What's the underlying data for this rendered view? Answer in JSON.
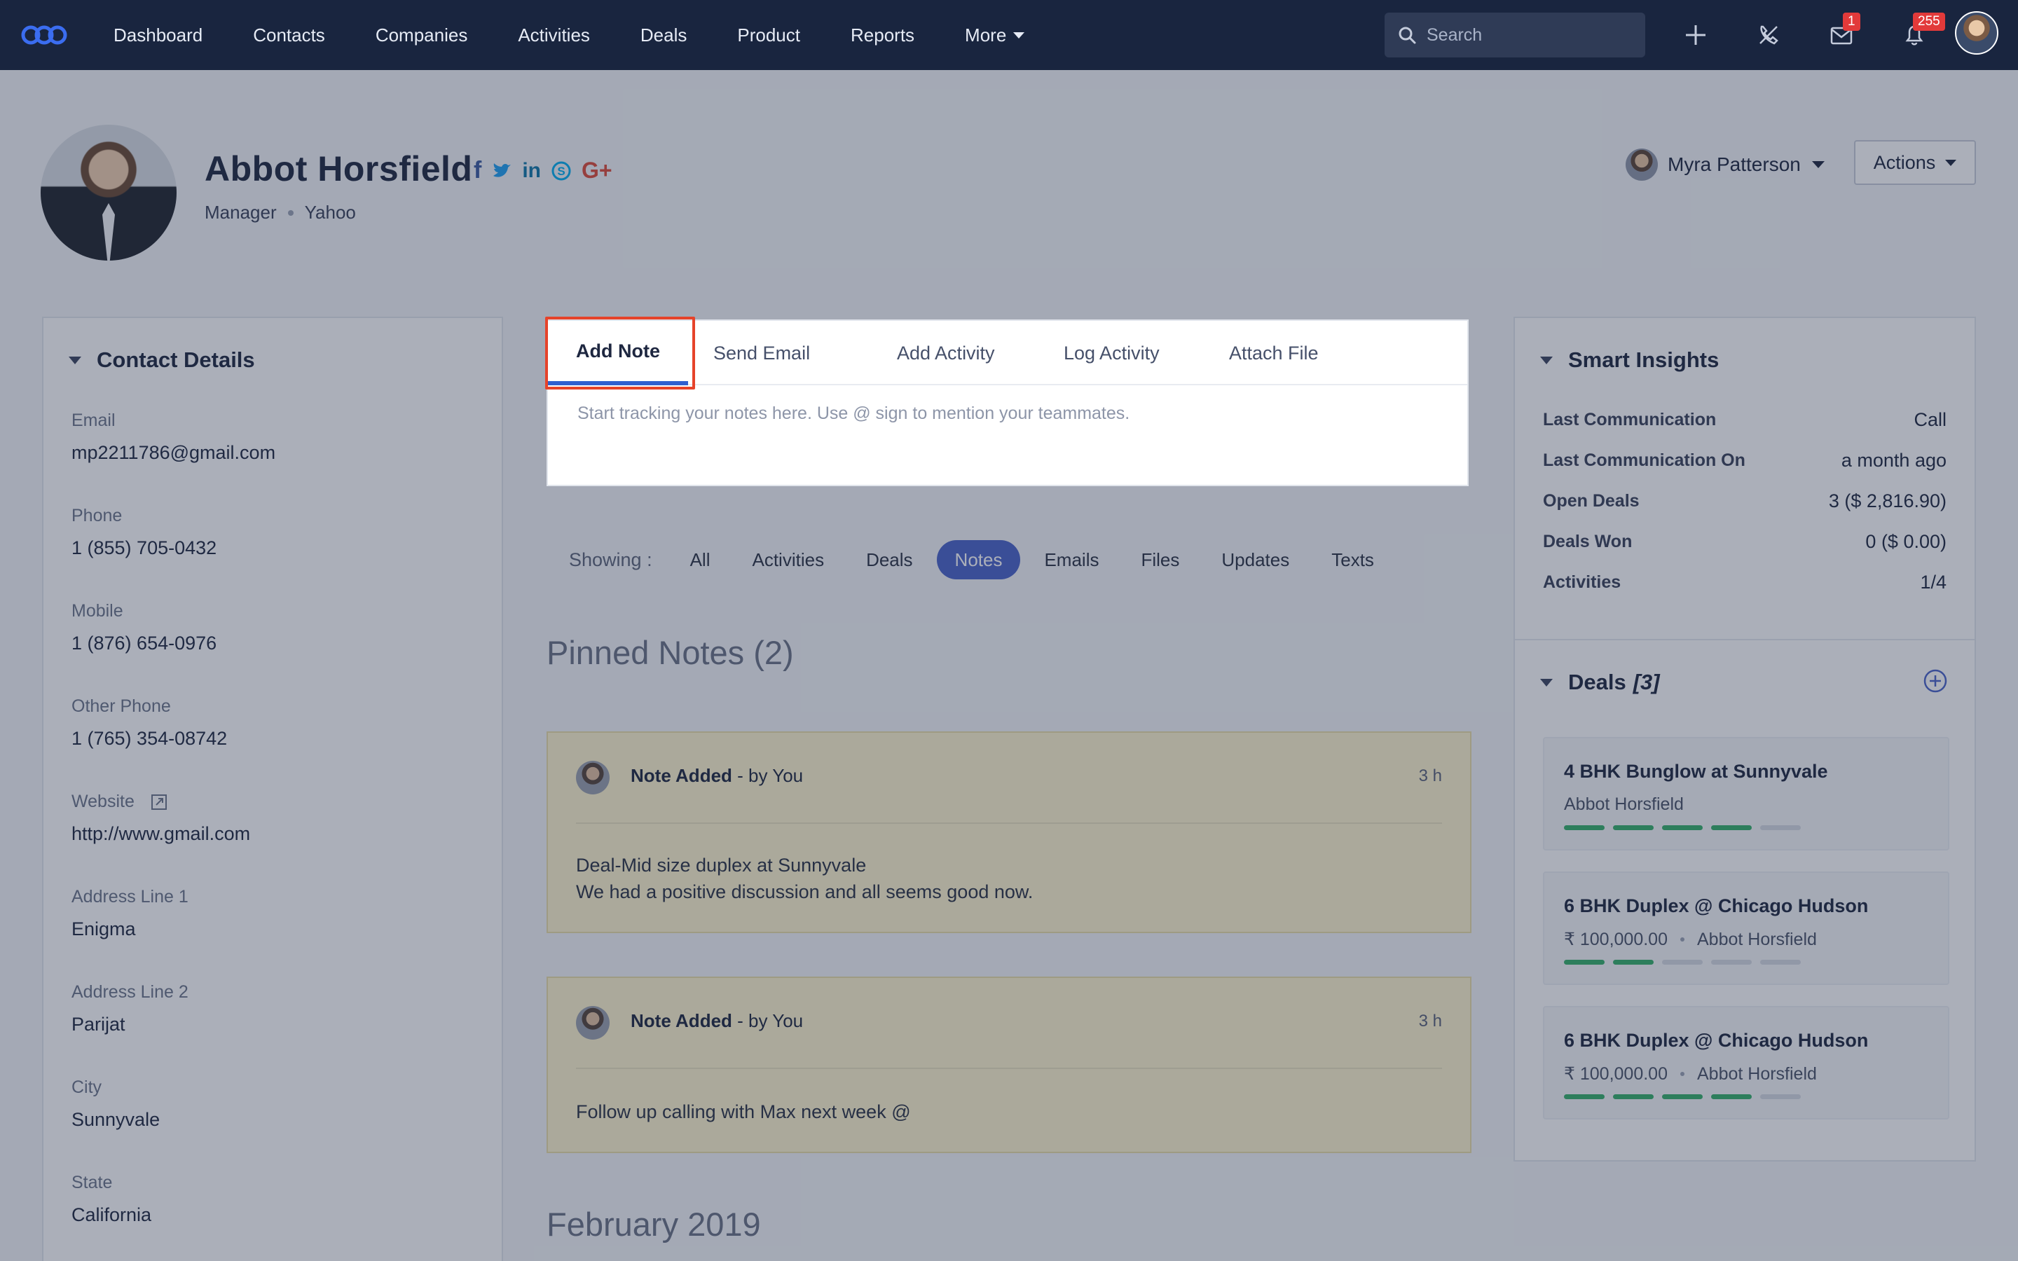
{
  "nav": {
    "items": [
      "Dashboard",
      "Contacts",
      "Companies",
      "Activities",
      "Deals",
      "Product",
      "Reports"
    ],
    "more_label": "More",
    "search_placeholder": "Search",
    "mail_badge": "1",
    "notification_badge": "255"
  },
  "contact": {
    "name": "Abbot Horsfield",
    "title": "Manager",
    "company": "Yahoo",
    "owner": "Myra Patterson",
    "actions_label": "Actions"
  },
  "contact_details": {
    "heading": "Contact Details",
    "fields": [
      {
        "label": "Email",
        "value": "mp2211786@gmail.com"
      },
      {
        "label": "Phone",
        "value": "1 (855) 705-0432"
      },
      {
        "label": "Mobile",
        "value": "1 (876) 654-0976"
      },
      {
        "label": "Other Phone",
        "value": "1 (765) 354-08742"
      },
      {
        "label": "Website",
        "value": "http://www.gmail.com"
      },
      {
        "label": "Address Line 1",
        "value": "Enigma"
      },
      {
        "label": "Address Line 2",
        "value": "Parijat"
      },
      {
        "label": "City",
        "value": "Sunnyvale"
      },
      {
        "label": "State",
        "value": "California"
      }
    ]
  },
  "composer": {
    "tabs": [
      "Add Note",
      "Send Email",
      "Add Activity",
      "Log Activity",
      "Attach File"
    ],
    "placeholder": "Start tracking your notes here. Use @ sign to mention your teammates."
  },
  "filters": {
    "label": "Showing :",
    "items": [
      "All",
      "Activities",
      "Deals",
      "Notes",
      "Emails",
      "Files",
      "Updates",
      "Texts"
    ],
    "active": "Notes"
  },
  "pinned_heading": "Pinned Notes (2)",
  "notes": [
    {
      "title": "Note Added",
      "by": " - by You",
      "time": "3 h",
      "line1": "Deal-Mid size duplex at Sunnyvale",
      "line2": "We had a positive discussion and all seems good now."
    },
    {
      "title": "Note Added",
      "by": " - by You",
      "time": "3 h",
      "line1": "Follow up calling with Max next week @",
      "line2": ""
    }
  ],
  "month_heading": "February 2019",
  "insights": {
    "heading": "Smart Insights",
    "rows": [
      {
        "key": "Last Communication",
        "value": "Call"
      },
      {
        "key": "Last Communication On",
        "value": "a month ago"
      },
      {
        "key": "Open Deals",
        "value": "3 ($ 2,816.90)"
      },
      {
        "key": "Deals Won",
        "value": "0 ($ 0.00)"
      },
      {
        "key": "Activities",
        "value": "1/4"
      }
    ]
  },
  "deals": {
    "heading": "Deals",
    "count": "[3]",
    "cards": [
      {
        "title": "4 BHK Bunglow at Sunnyvale",
        "amount": "",
        "contact": "Abbot Horsfield",
        "stages_done": 4,
        "stages_total": 5
      },
      {
        "title": "6 BHK Duplex @ Chicago Hudson",
        "amount": "₹ 100,000.00",
        "contact": "Abbot Horsfield",
        "stages_done": 2,
        "stages_total": 5
      },
      {
        "title": "6 BHK Duplex @ Chicago Hudson",
        "amount": "₹ 100,000.00",
        "contact": "Abbot Horsfield",
        "stages_done": 4,
        "stages_total": 5
      }
    ]
  },
  "colors": {
    "nav_bg": "#19253f",
    "accent": "#4a63c8",
    "tab_underline": "#2f5fd0",
    "highlight": "#e6432a",
    "note_bg": "#fff6cf",
    "stage_done": "#35b06a"
  }
}
